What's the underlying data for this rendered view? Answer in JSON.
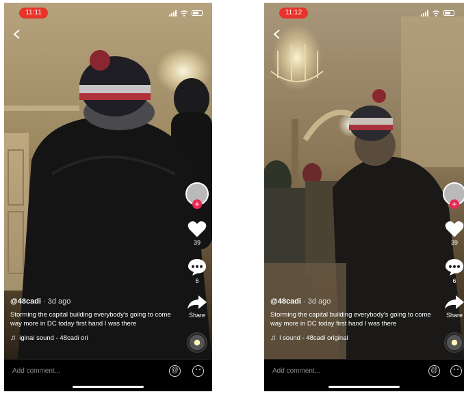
{
  "phones": [
    {
      "status_time": "11:11",
      "likes": "39",
      "comments": "6",
      "share_label": "Share",
      "handle": "@48cadi",
      "ago": " · 3d ago",
      "description": "Storming the capital building everybody's going to come way more in DC today first hand I was there",
      "sound": "iginal sound - 48cadi    ori",
      "comment_placeholder": "Add comment...",
      "at_symbol": "@"
    },
    {
      "status_time": "11:12",
      "likes": "39",
      "comments": "6",
      "share_label": "Share",
      "handle": "@48cadi",
      "ago": " · 3d ago",
      "description": "Storming the capital building everybody's going to come way more in DC today first hand I was there",
      "sound": "l sound - 48cadi    original",
      "comment_placeholder": "Add comment...",
      "at_symbol": "@"
    }
  ],
  "colors": {
    "time_pill": "#e8332b",
    "follow_plus": "#ea2a55"
  },
  "icons": [
    "back-chevron-icon",
    "signal-icon",
    "wifi-icon",
    "battery-icon",
    "heart-icon",
    "comment-icon",
    "share-icon",
    "music-note-icon",
    "at-icon",
    "emoji-icon"
  ]
}
